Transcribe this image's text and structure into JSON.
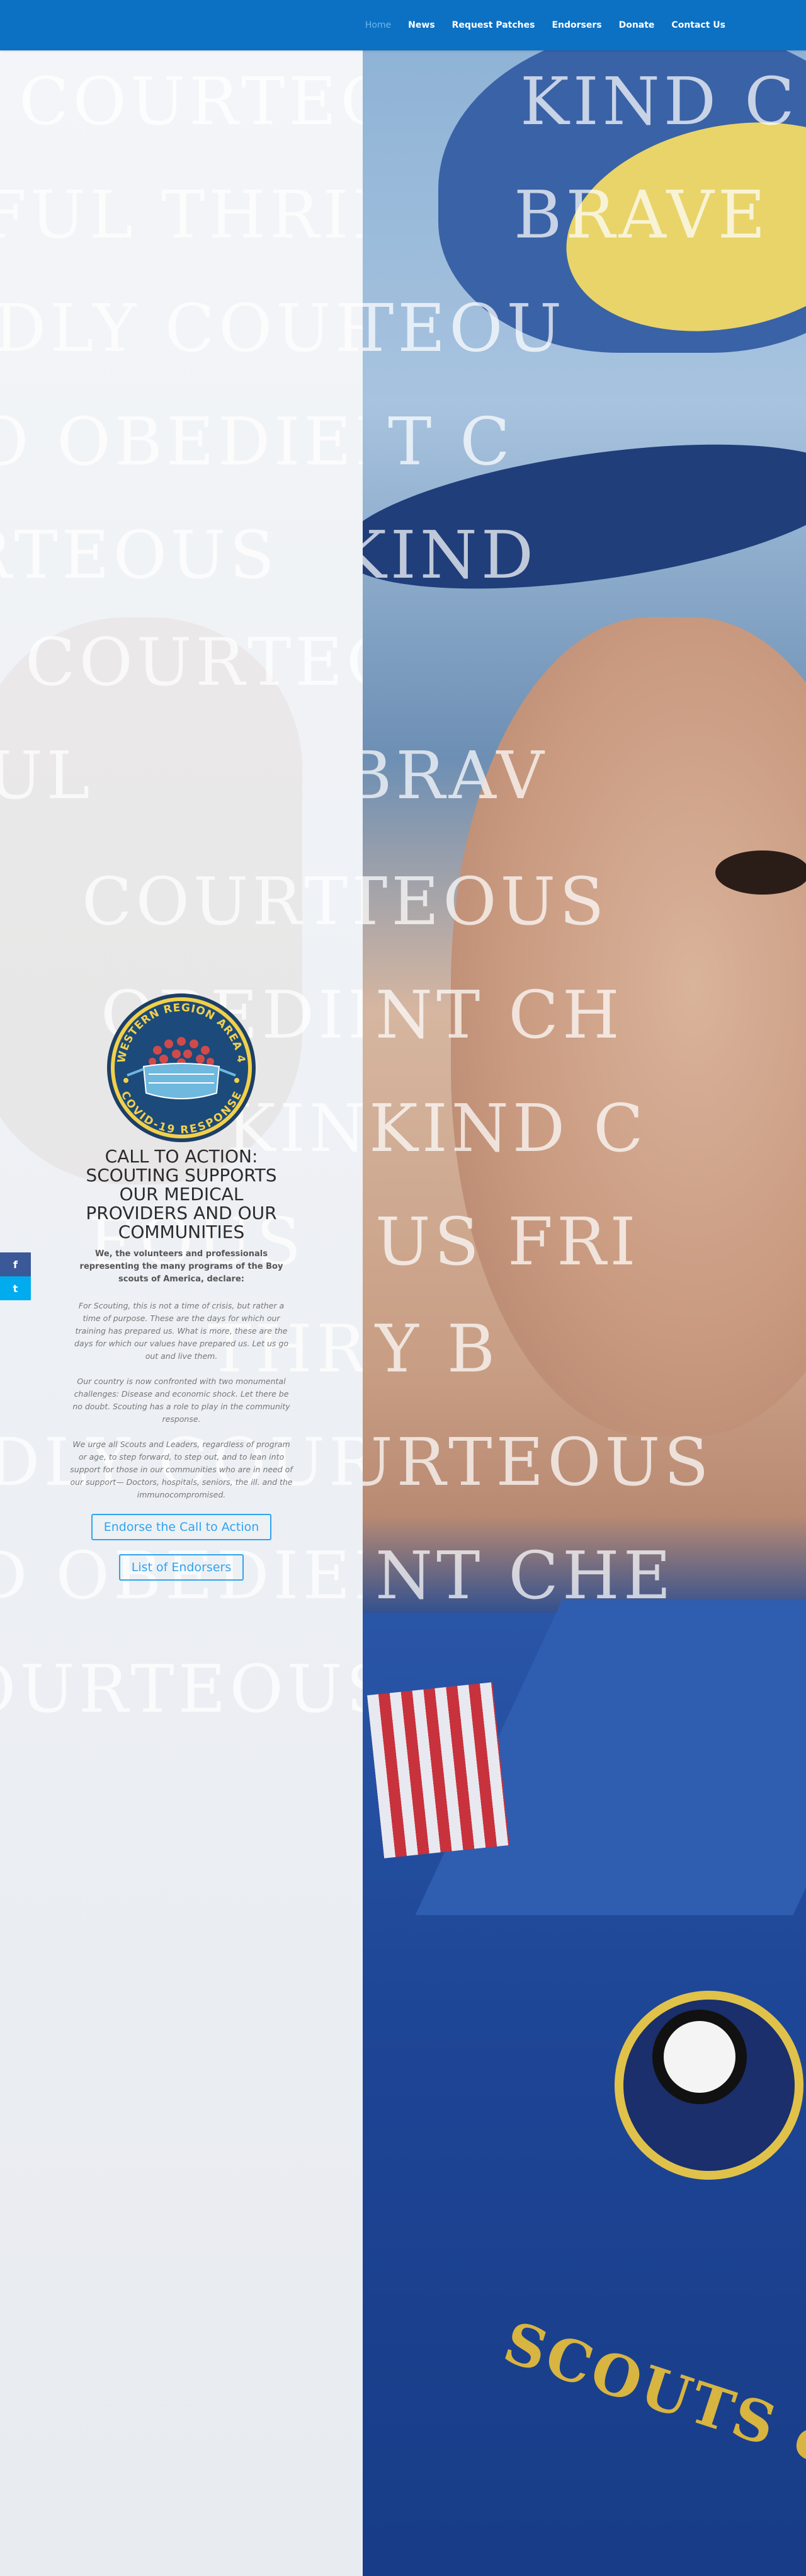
{
  "nav": {
    "items": [
      {
        "label": "Home",
        "active": true
      },
      {
        "label": "News"
      },
      {
        "label": "Request Patches"
      },
      {
        "label": "Endorsers"
      },
      {
        "label": "Donate"
      },
      {
        "label": "Contact Us"
      }
    ]
  },
  "background_words": {
    "left": [
      "COURTEOUS",
      "FUL  THRIFTY",
      "DLY  COURTEOUS",
      "O  OBEDIENT",
      "RTEOUS",
      "COURTEO",
      "UL",
      "COURTEOUS",
      "OBEDIENT",
      "KIND",
      "EOUS",
      "THRIFTY",
      "DLY  COURTE",
      "D  OBEDIENT",
      "OURTEOUS"
    ],
    "right": [
      "KIND  C",
      "BRAVE",
      "TEOU",
      "T  C",
      "KIND",
      "BRAV",
      "TEOUS",
      "NT  CH",
      "KIND  C",
      "US  FRI",
      "Y  B",
      "URTEOUS",
      "NT  CHE"
    ]
  },
  "badge": {
    "top_text": "WESTERN REGION AREA 4",
    "bottom_text": "COVID-19 RESPONSE",
    "colors": {
      "ring": "#f2d04a",
      "field": "#1c4a7a",
      "mask": "#6fb8de",
      "virus": "#d04a4a"
    }
  },
  "cta": {
    "title": "CALL TO ACTION: SCOUTING SUPPORTS OUR MEDICAL PROVIDERS AND OUR COMMUNITIES",
    "lead": "We, the volunteers and professionals representing the many programs of the Boy scouts of America, declare:",
    "paragraphs": [
      "For Scouting, this is not a time of crisis, but rather a time of purpose. These are the days for which our training has prepared us. What is more, these are the days for which our values have prepared us. Let us go out and live them.",
      "Our country is now confronted with two monumental challenges:  Disease and economic shock.  Let there be no doubt. Scouting has a role to play in the community response.",
      "We urge all Scouts and Leaders, regardless of program or age, to step forward, to step out, and to lean into support for those in our communities who are in need of our support— Doctors, hospitals, seniors, the ill. and the immunocompromised."
    ],
    "button_endorse": "Endorse the Call to Action",
    "button_list": "List of Endorsers"
  },
  "share": {
    "facebook": "f",
    "twitter": "t"
  },
  "photo": {
    "patch_text": "SCOUTS of AMERICA"
  },
  "colors": {
    "header": "#0c71c3",
    "accent": "#2ea3f2"
  }
}
